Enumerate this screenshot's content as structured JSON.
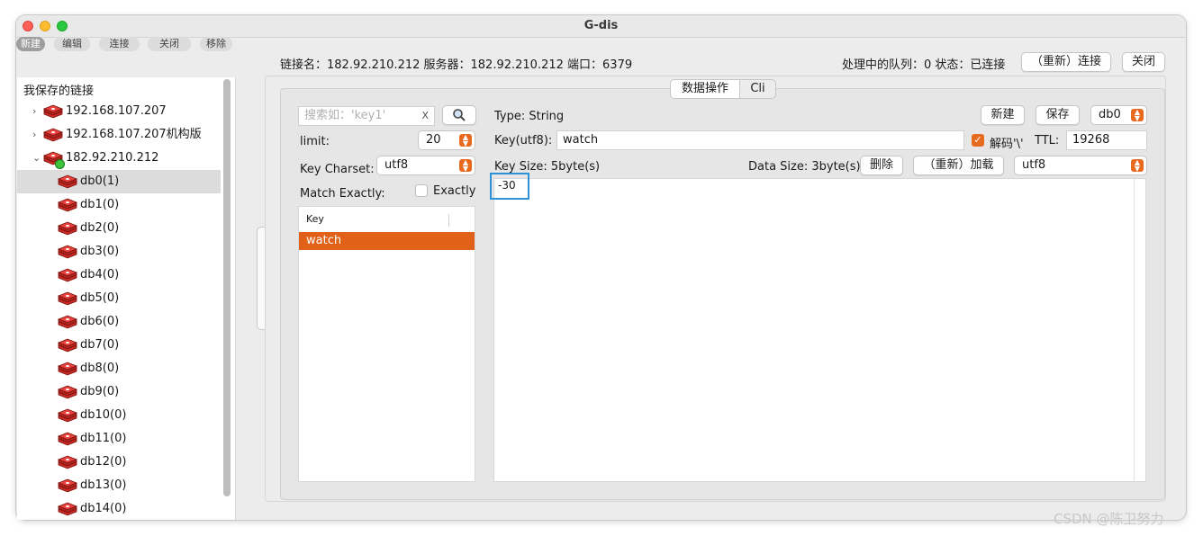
{
  "window": {
    "title": "G-dis"
  },
  "toolbar": {
    "new": "新建",
    "edit": "编辑",
    "connect": "连接",
    "close": "关闭",
    "remove": "移除"
  },
  "tree": {
    "header": "我保存的链接",
    "connections": [
      "192.168.107.207",
      "192.168.107.207机构版",
      "182.92.210.212"
    ],
    "dbs": [
      "db0(1)",
      "db1(0)",
      "db2(0)",
      "db3(0)",
      "db4(0)",
      "db5(0)",
      "db6(0)",
      "db7(0)",
      "db8(0)",
      "db9(0)",
      "db10(0)",
      "db11(0)",
      "db12(0)",
      "db13(0)",
      "db14(0)"
    ]
  },
  "status": {
    "connection_info": "链接名：182.92.210.212 服务器：182.92.210.212 端口：6379",
    "queue": "处理中的队列：0  状态：已连接",
    "reconnect_button": "（重新）连接",
    "close_button": "关闭"
  },
  "tabs": {
    "data_ops": "数据操作",
    "cli": "Cli"
  },
  "search": {
    "placeholder": "搜索如：'key1'",
    "clear": "X"
  },
  "filters": {
    "limit_label": "limit:",
    "limit_value": "20",
    "charset_label": "Key Charset:",
    "charset_value": "utf8",
    "match_label": "Match Exactly:",
    "exactly_label": "Exactly"
  },
  "keys": {
    "column_header": "Key",
    "items": [
      "watch"
    ]
  },
  "detail": {
    "type": "Type: String",
    "new_button": "新建",
    "save_button": "保存",
    "db_value": "db0",
    "key_label": "Key(utf8):",
    "key_value": "watch",
    "decode_label": "解码'\\'",
    "ttl_label": "TTL:",
    "ttl_value": "19268",
    "key_size": "Key Size: 5byte(s)",
    "data_size": "Data Size: 3byte(s)",
    "delete_button": "删除",
    "reload_button": "（重新）加载",
    "value_charset": "utf8",
    "value": "-30"
  },
  "watermark": "CSDN @陈卫努力",
  "colors": {
    "accent": "#e86a1e",
    "selection": "#e06117",
    "highlight": "#2f92d6"
  }
}
